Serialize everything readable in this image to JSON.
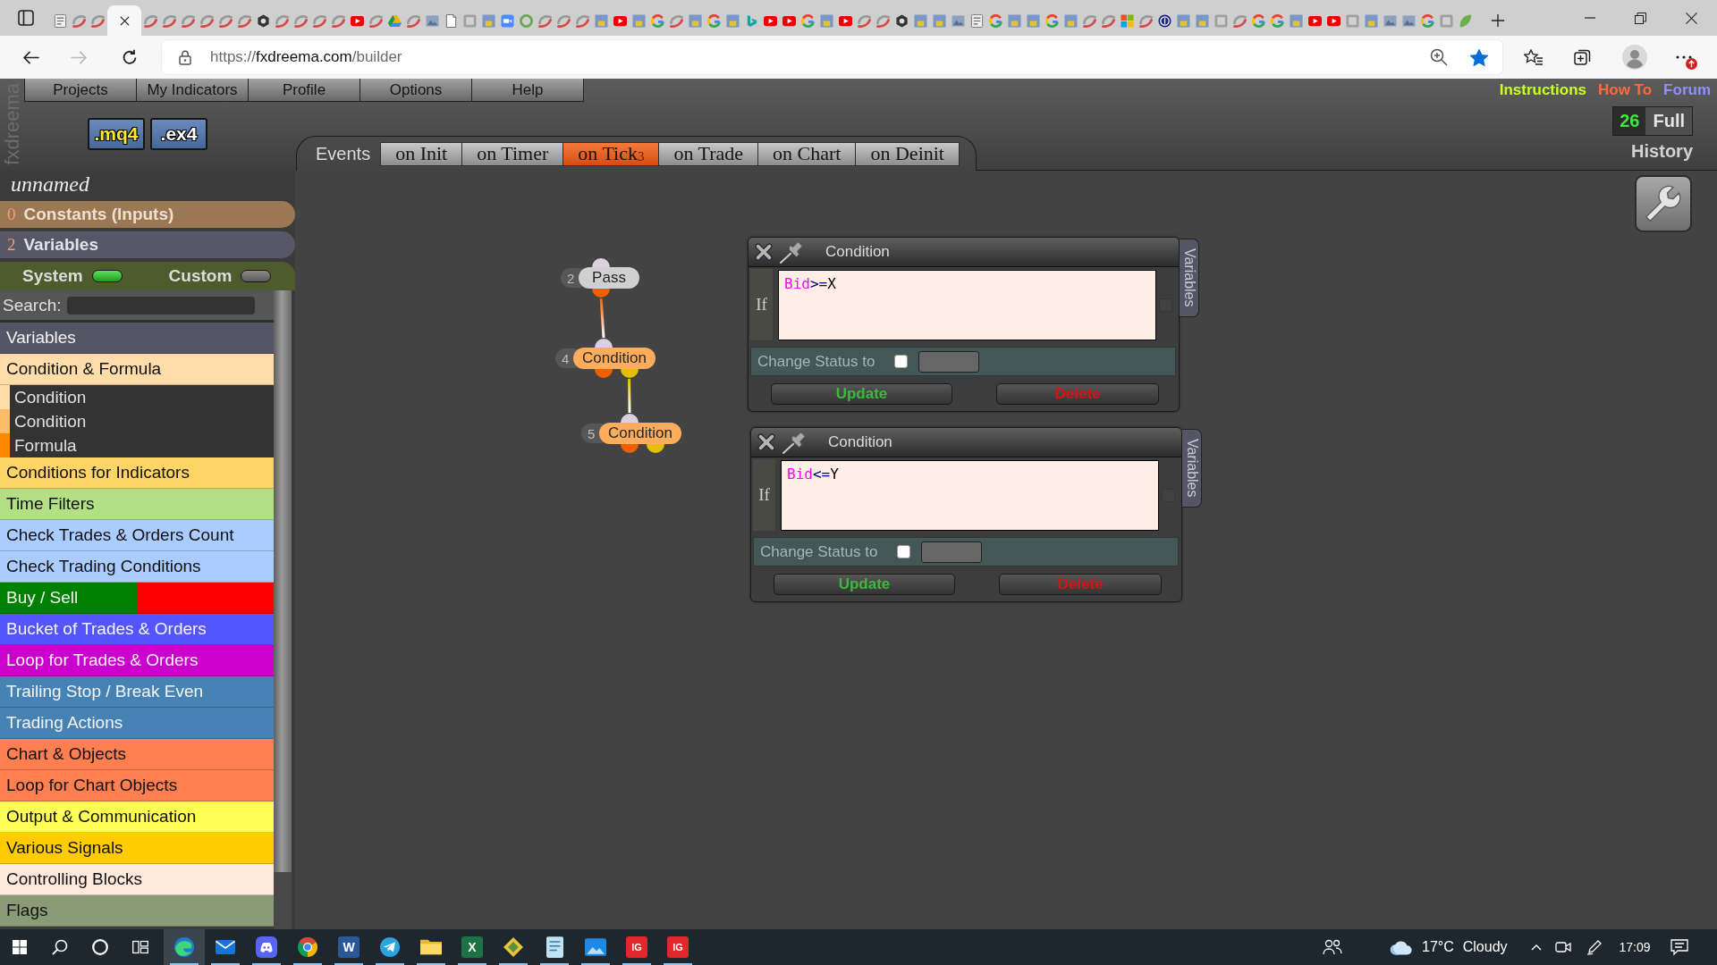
{
  "browser": {
    "tabs": [
      {
        "kind": "list",
        "selected": false
      },
      {
        "kind": "swirl",
        "selected": false
      },
      {
        "kind": "swirl",
        "selected": false
      },
      {
        "selected": true
      },
      {
        "kind": "swirl",
        "selected": false
      },
      {
        "kind": "swirl",
        "selected": false
      },
      {
        "kind": "swirl",
        "selected": false
      },
      {
        "kind": "swirl",
        "selected": false
      },
      {
        "kind": "swirl",
        "selected": false
      },
      {
        "kind": "swirl",
        "selected": false
      },
      {
        "kind": "hex",
        "selected": false
      },
      {
        "kind": "swirl",
        "selected": false
      },
      {
        "kind": "swirl",
        "selected": false
      },
      {
        "kind": "swirl",
        "selected": false
      },
      {
        "kind": "swirl",
        "selected": false
      },
      {
        "kind": "play",
        "selected": false
      },
      {
        "kind": "swirl",
        "selected": false
      },
      {
        "kind": "drive",
        "selected": false
      },
      {
        "kind": "swirl",
        "selected": false
      },
      {
        "kind": "image",
        "selected": false
      },
      {
        "kind": "page",
        "selected": false
      },
      {
        "kind": "tile",
        "selected": false
      },
      {
        "kind": "mql",
        "selected": false
      },
      {
        "kind": "camera",
        "selected": false
      },
      {
        "kind": "ring",
        "selected": false
      },
      {
        "kind": "swirl",
        "selected": false
      },
      {
        "kind": "swirl",
        "selected": false
      },
      {
        "kind": "swirl",
        "selected": false
      },
      {
        "kind": "mql",
        "selected": false
      },
      {
        "kind": "play",
        "selected": false
      },
      {
        "kind": "mql",
        "selected": false
      },
      {
        "kind": "g",
        "selected": false
      },
      {
        "kind": "swirl",
        "selected": false
      },
      {
        "kind": "mql",
        "selected": false
      },
      {
        "kind": "g",
        "selected": false
      },
      {
        "kind": "mql",
        "selected": false
      },
      {
        "kind": "bing",
        "selected": false
      },
      {
        "kind": "play",
        "selected": false
      },
      {
        "kind": "play",
        "selected": false
      },
      {
        "kind": "g",
        "selected": false
      },
      {
        "kind": "mql",
        "selected": false
      },
      {
        "kind": "play",
        "selected": false
      },
      {
        "kind": "swirl",
        "selected": false
      },
      {
        "kind": "swirl",
        "selected": false
      },
      {
        "kind": "hex",
        "selected": false
      },
      {
        "kind": "mql",
        "selected": false
      },
      {
        "kind": "mql",
        "selected": false
      },
      {
        "kind": "image",
        "selected": false
      },
      {
        "kind": "list",
        "selected": false
      },
      {
        "kind": "g",
        "selected": false
      },
      {
        "kind": "mql",
        "selected": false
      },
      {
        "kind": "mql",
        "selected": false
      },
      {
        "kind": "g",
        "selected": false
      },
      {
        "kind": "mql",
        "selected": false
      },
      {
        "kind": "swirl",
        "selected": false
      },
      {
        "kind": "swirl",
        "selected": false
      },
      {
        "kind": "grid",
        "selected": false
      },
      {
        "kind": "swirl",
        "selected": false
      },
      {
        "kind": "dollar",
        "selected": false
      },
      {
        "kind": "mql",
        "selected": false
      },
      {
        "kind": "mql",
        "selected": false
      },
      {
        "kind": "tile",
        "selected": false
      },
      {
        "kind": "swirl",
        "selected": false
      },
      {
        "kind": "g",
        "selected": false
      },
      {
        "kind": "g",
        "selected": false
      },
      {
        "kind": "mql",
        "selected": false
      },
      {
        "kind": "play",
        "selected": false
      },
      {
        "kind": "play",
        "selected": false
      },
      {
        "kind": "tile",
        "selected": false
      },
      {
        "kind": "mql",
        "selected": false
      },
      {
        "kind": "image",
        "selected": false
      },
      {
        "kind": "image",
        "selected": false
      },
      {
        "kind": "g",
        "selected": false
      },
      {
        "kind": "tile",
        "selected": false
      },
      {
        "kind": "leaf",
        "selected": false
      }
    ],
    "back": {
      "disabled": false
    },
    "forward": {
      "disabled": true
    },
    "url": "https://fxdreema.com/builder",
    "bookmarked": true,
    "update_badge": true
  },
  "app": {
    "side_logo": "fxdreema",
    "menu": [
      "Projects",
      "My Indicators",
      "Profile",
      "Options",
      "Help"
    ],
    "export_buttons": [
      {
        "label": ".mq4",
        "kind": "mq4"
      },
      {
        "label": ".ex4",
        "kind": "ex4"
      }
    ],
    "events": {
      "label": "Events",
      "tabs": [
        {
          "label": "on Init",
          "selected": false
        },
        {
          "label": "on Timer",
          "selected": false
        },
        {
          "label": "on Tick",
          "count": "3",
          "selected": true
        },
        {
          "label": "on Trade",
          "selected": false
        },
        {
          "label": "on Chart",
          "selected": false
        },
        {
          "label": "on Deinit",
          "selected": false
        }
      ]
    },
    "links": [
      {
        "label": "Instructions",
        "color": "#ccff22"
      },
      {
        "label": "How To",
        "color": "#ff6a3a"
      },
      {
        "label": "Forum",
        "color": "#9090ff"
      }
    ],
    "history": {
      "count": "26",
      "mode": "Full",
      "label": "History"
    }
  },
  "sidebar": {
    "project_name": "unnamed",
    "sections": [
      {
        "count": "0",
        "label": "Constants (Inputs)",
        "kind": "constants"
      },
      {
        "count": "2",
        "label": "Variables",
        "kind": "variables"
      }
    ],
    "scopes": [
      {
        "label": "System",
        "on": true
      },
      {
        "label": "Custom",
        "on": false
      }
    ],
    "search_label": "Search:",
    "categories": [
      {
        "label": "Variables",
        "color": "#555566"
      },
      {
        "label": "Condition & Formula",
        "color": "#ffddaa",
        "children": [
          {
            "label": "Condition",
            "color": "#ffddaa"
          },
          {
            "label": "Condition",
            "color": "#ffbb66"
          },
          {
            "label": "Formula",
            "color": "#ff8800"
          }
        ]
      },
      {
        "label": "Conditions for Indicators",
        "color": "#ffd466"
      },
      {
        "label": "Time Filters",
        "color": "#b3e085"
      },
      {
        "label": "Check Trades & Orders Count",
        "color": "#aaccff"
      },
      {
        "label": "Check Trading Conditions",
        "color": "#aaccff"
      },
      {
        "label": "Buy / Sell",
        "color": "#008000",
        "split": {
          "color": "#ff0000"
        }
      },
      {
        "label": "Bucket of Trades & Orders",
        "color": "#5555ff"
      },
      {
        "label": "Loop for Trades & Orders",
        "color": "#cc00cc"
      },
      {
        "label": "Trailing Stop / Break Even",
        "color": "#4682b4"
      },
      {
        "label": "Trading Actions",
        "color": "#4682b4"
      },
      {
        "label": "Chart & Objects",
        "color": "#ff7f50"
      },
      {
        "label": "Loop for Chart Objects",
        "color": "#ff7f50"
      },
      {
        "label": "Output & Communication",
        "color": "#ffff55"
      },
      {
        "label": "Various Signals",
        "color": "#ffcc00"
      },
      {
        "label": "Controlling Blocks",
        "color": "#ffe8dc"
      },
      {
        "label": "Flags",
        "color": "#8b9b78"
      }
    ]
  },
  "canvas": {
    "flow": {
      "number": "2",
      "label": "Pass",
      "kind": "pass",
      "children": [
        {
          "number": "4",
          "label": "Condition",
          "kind": "condition",
          "children": [
            {
              "number": "5",
              "label": "Condition",
              "kind": "condition"
            }
          ]
        }
      ]
    },
    "panels": [
      {
        "title": "Condition",
        "condition_label": "If",
        "expression": [
          {
            "text": "Bid",
            "kind": "builtin"
          },
          {
            "text": ">=",
            "kind": "operator"
          },
          {
            "text": "X",
            "kind": "name"
          }
        ],
        "status_label": "Change Status to",
        "status_checked": false,
        "buttons": [
          {
            "label": "Update",
            "kind": "update"
          },
          {
            "label": "Delete",
            "kind": "delete"
          }
        ],
        "side_tab": "Variables"
      },
      {
        "title": "Condition",
        "condition_label": "If",
        "expression": [
          {
            "text": "Bid",
            "kind": "builtin"
          },
          {
            "text": "<=",
            "kind": "operator"
          },
          {
            "text": "Y",
            "kind": "name"
          }
        ],
        "status_label": "Change Status to",
        "status_checked": false,
        "buttons": [
          {
            "label": "Update",
            "kind": "update"
          },
          {
            "label": "Delete",
            "kind": "delete"
          }
        ],
        "side_tab": "Variables"
      }
    ]
  },
  "taskbar": {
    "apps": [
      {
        "kind": "edge",
        "selected": true,
        "running": true
      },
      {
        "kind": "mail",
        "selected": false,
        "running": true
      },
      {
        "kind": "discord",
        "selected": false,
        "running": true
      },
      {
        "kind": "chrome",
        "selected": false,
        "running": true
      },
      {
        "kind": "word",
        "label": "W",
        "selected": false,
        "running": true
      },
      {
        "kind": "telegram",
        "selected": false,
        "running": true
      },
      {
        "kind": "folder",
        "selected": false,
        "running": true
      },
      {
        "kind": "excel",
        "label": "X",
        "selected": false,
        "running": true
      },
      {
        "kind": "app",
        "selected": false,
        "running": true
      },
      {
        "kind": "notepad",
        "selected": false,
        "running": true
      },
      {
        "kind": "photos",
        "selected": false,
        "running": true
      },
      {
        "kind": "ig",
        "label": "IG",
        "selected": false,
        "running": true
      },
      {
        "kind": "ig",
        "label": "IG",
        "selected": false,
        "running": true
      }
    ],
    "weather": {
      "temperature": "17°C",
      "condition": "Cloudy"
    },
    "time": "17:09"
  }
}
